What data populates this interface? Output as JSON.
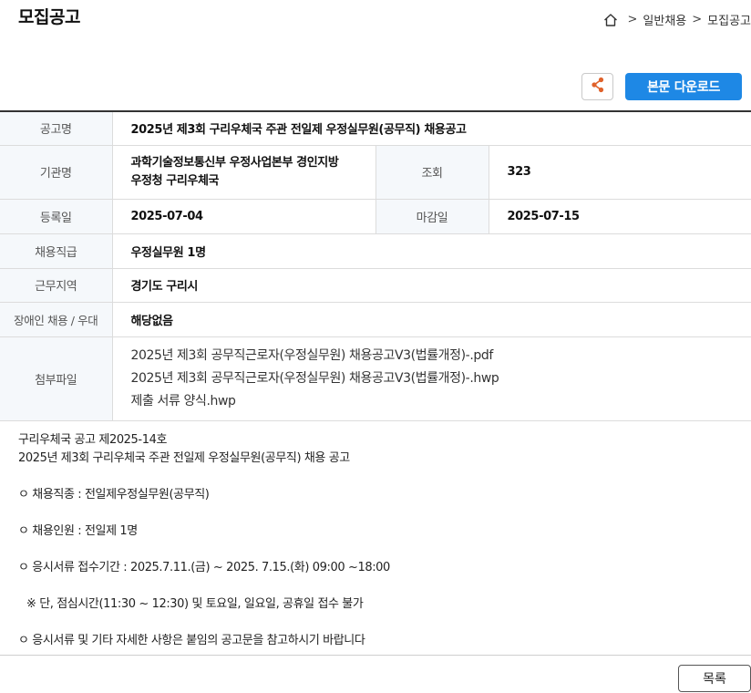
{
  "header": {
    "title": "모집공고",
    "breadcrumb": {
      "home_icon": "home-icon",
      "separator": ">",
      "items": [
        "일반채용",
        "모집공고"
      ]
    }
  },
  "toolbar": {
    "share_icon": "share-icon",
    "download_label": "본문 다운로드",
    "accent_color": "#1e88e5"
  },
  "info": {
    "title_label": "공고명",
    "title_value": "2025년 제3회 구리우체국 주관 전일제 우정실무원(공무직) 채용공고",
    "agency_label": "기관명",
    "agency_value_line1": "과학기술정보통신부 우정사업본부 경인지방",
    "agency_value_line2": "우정청 구리우체국",
    "views_label": "조회",
    "views_value": "323",
    "reg_date_label": "등록일",
    "reg_date_value": "2025-07-04",
    "deadline_label": "마감일",
    "deadline_value": "2025-07-15",
    "position_label": "채용직급",
    "position_value": "우정실무원 1명",
    "region_label": "근무지역",
    "region_value": "경기도 구리시",
    "disability_label": "장애인 채용 / 우대",
    "disability_value": "해당없음",
    "attachments_label": "첨부파일",
    "attachments": [
      "2025년 제3회 공무직근로자(우정실무원) 채용공고V3(법률개정)-.pdf",
      "2025년 제3회 공무직근로자(우정실무원) 채용공고V3(법률개정)-.hwp",
      "제출 서류 양식.hwp"
    ]
  },
  "body": {
    "lines": [
      "구리우체국 공고 제2025-14호",
      "2025년 제3회 구리우체국 주관  전일제 우정실무원(공무직) 채용 공고",
      "ㅇ 채용직종 : 전일제우정실무원(공무직)",
      "ㅇ 채용인원 : 전일제 1명",
      "ㅇ 응시서류 접수기간 : 2025.7.11.(금) ~ 2025. 7.15.(화) 09:00 ~18:00",
      "※ 단, 점심시간(11:30 ~ 12:30) 및 토요일, 일요일, 공휴일 접수 불가",
      "ㅇ 응시서류 및 기타 자세한 사항은 붙임의 공고문을 참고하시기 바랍니다"
    ]
  },
  "footer": {
    "list_button_label": "목록"
  }
}
